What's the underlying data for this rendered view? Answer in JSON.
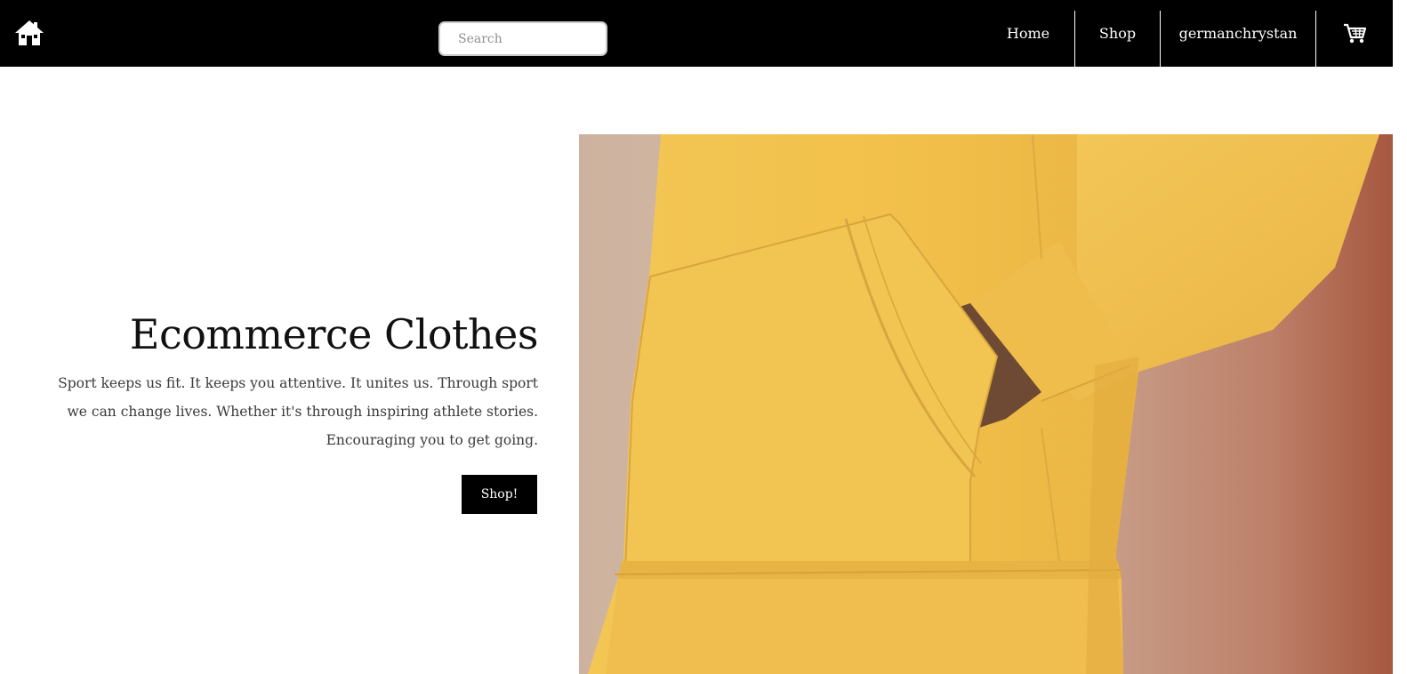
{
  "header": {
    "home_icon": "home-icon",
    "search": {
      "placeholder": "Search",
      "value": ""
    },
    "nav": {
      "home_label": "Home",
      "shop_label": "Shop",
      "user_label": "germanchrystan",
      "cart_icon": "shopping-cart-icon"
    }
  },
  "hero": {
    "title": "Ecommerce Clothes",
    "description": "Sport keeps us fit. It keeps you attentive. It unites us. Through sport we can change lives. Whether it's through inspiring athlete stories. Encouraging you to get going.",
    "button_label": "Shop!",
    "image": "yellow-hoodie-photo"
  },
  "colors": {
    "header_bg": "#000000",
    "button_bg": "#000000",
    "text": "#111111",
    "hoodie": "#f1c04c"
  }
}
